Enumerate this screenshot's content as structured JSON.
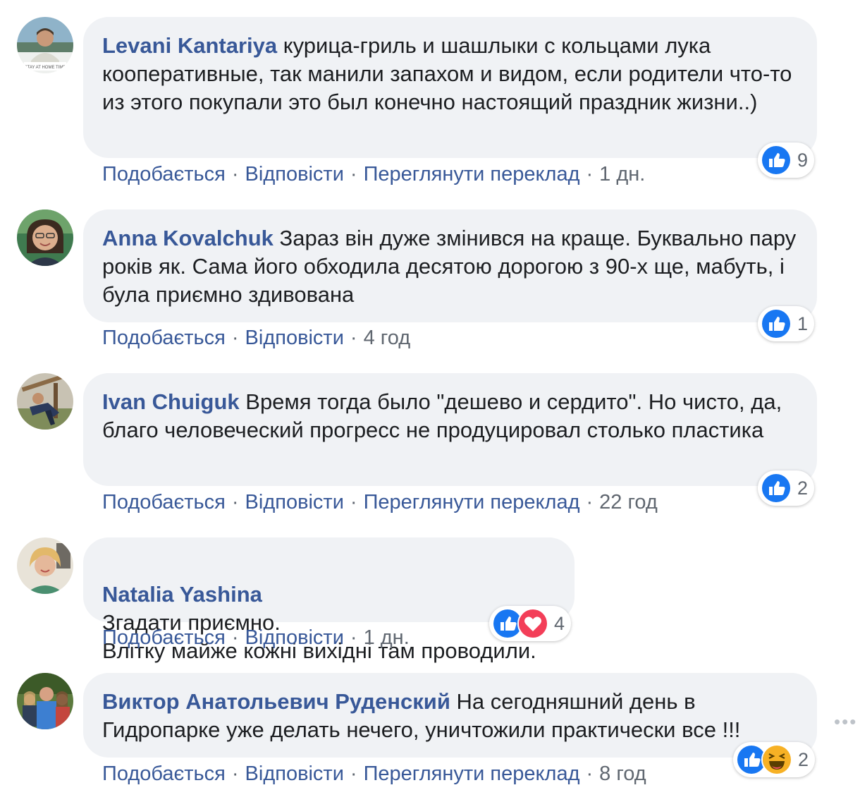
{
  "comments": [
    {
      "author": "Levani Kantariya",
      "text": "курица-гриль и шашлыки с кольцами лука кооперативные, так манили запахом и видом, если родители что-то из этого покупали это был конечно настоящий праздник жизни..)",
      "actions": [
        "Подобається",
        "Відповісти",
        "Переглянути переклад"
      ],
      "time": "1 дн.",
      "reaction_count": "9",
      "reactions": [
        "like-icon"
      ]
    },
    {
      "author": "Anna Kovalchuk",
      "text": "Зараз він дуже змінився на краще. Буквально пару років як. Сама його обходила десятою дорогою з 90-х ще, мабуть, і була приємно здивована",
      "actions": [
        "Подобається",
        "Відповісти"
      ],
      "time": "4 год",
      "reaction_count": "1",
      "reactions": [
        "like-icon"
      ]
    },
    {
      "author": "Ivan Chuiguk",
      "text": "Время тогда было \"дешево и сердито\". Но чисто, да, благо человеческий прогресс не продуцировал столько пластика",
      "actions": [
        "Подобається",
        "Відповісти",
        "Переглянути переклад"
      ],
      "time": "22 год",
      "reaction_count": "2",
      "reactions": [
        "like-icon"
      ]
    },
    {
      "author": "Natalia Yashina",
      "text": "Згадати приємно.\nВлітку майже кожні вихідні там проводили.",
      "actions": [
        "Подобається",
        "Відповісти"
      ],
      "time": "1 дн.",
      "reaction_count": "4",
      "reactions": [
        "like-icon",
        "love-icon"
      ]
    },
    {
      "author": "Виктор Анатольевич Руденский",
      "text": "На сегодняшний день в Гидропарке уже делать нечего, уничтожили практически все !!!",
      "actions": [
        "Подобається",
        "Відповісти",
        "Переглянути переклад"
      ],
      "time": "8 год",
      "reaction_count": "2",
      "reactions": [
        "like-icon",
        "haha-icon"
      ]
    }
  ],
  "avatar_caption_1": "STAY AT HOME TIME",
  "more_icon": "more-options-icon",
  "colors": {
    "author": "#385898",
    "bubble": "#f0f2f5",
    "meta": "#606770",
    "like": "#1877f2",
    "love": "#f33e58",
    "haha": "#f7b125"
  }
}
